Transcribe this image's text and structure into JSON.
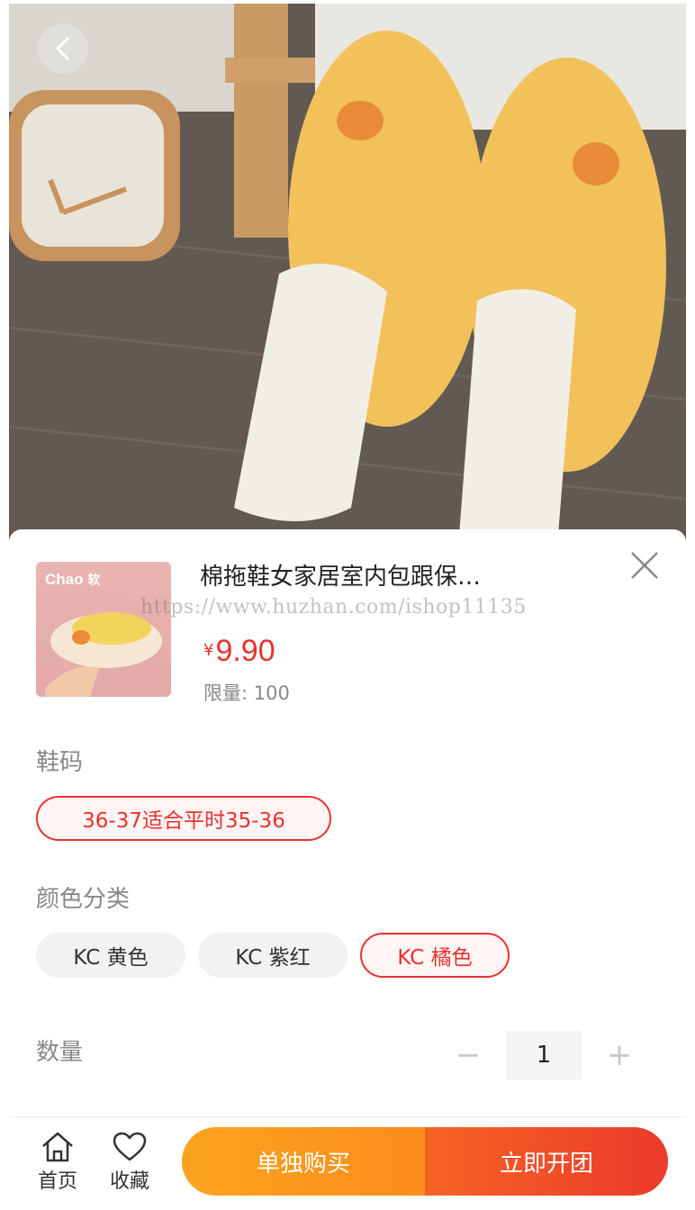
{
  "product": {
    "title": "棉拖鞋女家居室内包跟保…",
    "currency": "¥",
    "price": "9.90",
    "limit": "限量: 100",
    "thumb_brand": "Chao",
    "thumb_brand_sub": "软"
  },
  "watermark": "https://www.huzhan.com/ishop11135",
  "size_section": {
    "label": "鞋码",
    "options": [
      {
        "label": "36-37适合平时35-36",
        "selected": true
      }
    ]
  },
  "color_section": {
    "label": "颜色分类",
    "options": [
      {
        "label": "KC 黄色",
        "selected": false
      },
      {
        "label": "KC 紫红",
        "selected": false
      },
      {
        "label": "KC 橘色",
        "selected": true
      }
    ]
  },
  "quantity": {
    "label": "数量",
    "minus": "−",
    "value": "1",
    "plus": "+"
  },
  "bottom_bar": {
    "home_label": "首页",
    "favorite_label": "收藏",
    "buy_alone_label": "单独购买",
    "group_buy_label": "立即开团"
  },
  "colors": {
    "accent_red": "#e8322f",
    "buy_alone": "#fb9a1e",
    "group_buy": "#ee4128"
  },
  "icons": [
    "back-icon",
    "close-icon",
    "home-icon",
    "heart-icon"
  ]
}
